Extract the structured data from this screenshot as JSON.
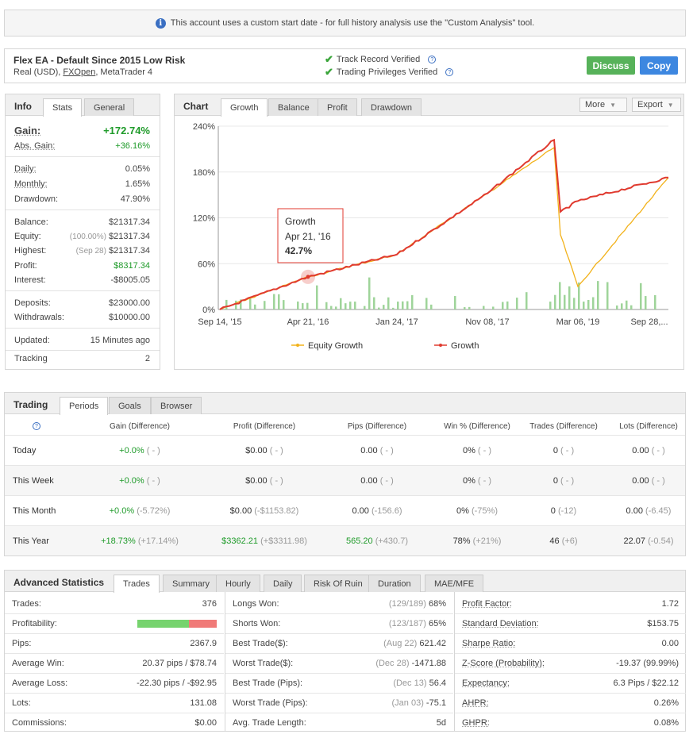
{
  "notice": {
    "text": "This account uses a custom start date - for full history analysis use the \"Custom Analysis\" tool."
  },
  "header": {
    "name": "Flex EA - Default Since 2015 Low Risk",
    "sub_pre": "Real (USD), ",
    "sub_broker": "FXOpen",
    "sub_post": ", MetaTrader 4",
    "track_record": "Track Record Verified",
    "trading_privileges": "Trading Privileges Verified",
    "discuss": "Discuss",
    "copy": "Copy"
  },
  "info": {
    "title": "Info",
    "tabs": [
      "Stats",
      "General"
    ],
    "gain_label": "Gain:",
    "gain_value": "+172.74%",
    "abs_gain_label": "Abs. Gain:",
    "abs_gain_value": "+36.16%",
    "daily_label": "Daily:",
    "daily_value": "0.05%",
    "monthly_label": "Monthly:",
    "monthly_value": "1.65%",
    "drawdown_label": "Drawdown:",
    "drawdown_value": "47.90%",
    "balance_label": "Balance:",
    "balance_value": "$21317.34",
    "equity_label": "Equity:",
    "equity_pct": "(100.00%)",
    "equity_value": "$21317.34",
    "highest_label": "Highest:",
    "highest_date": "(Sep 28)",
    "highest_value": "$21317.34",
    "profit_label": "Profit:",
    "profit_value": "$8317.34",
    "interest_label": "Interest:",
    "interest_value": "-$8005.05",
    "deposits_label": "Deposits:",
    "deposits_value": "$23000.00",
    "withdrawals_label": "Withdrawals:",
    "withdrawals_value": "$10000.00",
    "updated_label": "Updated:",
    "updated_value": "15 Minutes ago",
    "tracking_label": "Tracking",
    "tracking_value": "2"
  },
  "chart": {
    "title": "Chart",
    "tabs": [
      "Growth",
      "Balance",
      "Profit",
      "Drawdown"
    ],
    "more": "More",
    "export": "Export",
    "tooltip": {
      "series": "Growth",
      "date": "Apr 21, '16",
      "value": "42.7%"
    },
    "legend": [
      "Equity Growth",
      "Growth"
    ],
    "colors": {
      "growth": "#e03a2f",
      "equity": "#f2b21b",
      "bars": "#9fd49a"
    }
  },
  "chart_data": {
    "type": "line",
    "x_tick_labels": [
      "Sep 14, '15",
      "Apr 21, '16",
      "Jan 24, '17",
      "Nov 08, '17",
      "Mar 06, '19",
      "Sep 28,..."
    ],
    "y_tick_labels": [
      "0%",
      "60%",
      "120%",
      "180%",
      "240%"
    ],
    "ylim": [
      0,
      240
    ],
    "series": [
      {
        "name": "Growth",
        "x": [
          "Sep 14, '15",
          "Apr 21, '16",
          "Jan 24, '17",
          "Nov 08, '17",
          "Aug 2018",
          "Sep 2018",
          "Mar 06, '19",
          "Sep 28, '19"
        ],
        "values": [
          0,
          42.7,
          72,
          152,
          222,
          128,
          142,
          172.7
        ]
      },
      {
        "name": "Equity Growth",
        "x": [
          "Sep 14, '15",
          "Apr 21, '16",
          "Jan 24, '17",
          "Nov 08, '17",
          "Aug 2018",
          "Sep 2018",
          "Mar 06, '19",
          "Sep 28, '19"
        ],
        "values": [
          0,
          42.7,
          72,
          152,
          212,
          98,
          30,
          172.7
        ]
      }
    ]
  },
  "trading": {
    "title": "Trading",
    "tabs": [
      "Periods",
      "Goals",
      "Browser"
    ],
    "headers": [
      "Gain (Difference)",
      "Profit (Difference)",
      "Pips (Difference)",
      "Win % (Difference)",
      "Trades (Difference)",
      "Lots (Difference)"
    ],
    "rows": [
      {
        "period": "Today",
        "gain": "+0.0%",
        "gain_d": "( - )",
        "profit": "$0.00",
        "profit_d": "( - )",
        "pips": "0.00",
        "pips_d": "( - )",
        "win": "0%",
        "win_d": "( - )",
        "trades": "0",
        "trades_d": "( - )",
        "lots": "0.00",
        "lots_d": "( - )"
      },
      {
        "period": "This Week",
        "gain": "+0.0%",
        "gain_d": "( - )",
        "profit": "$0.00",
        "profit_d": "( - )",
        "pips": "0.00",
        "pips_d": "( - )",
        "win": "0%",
        "win_d": "( - )",
        "trades": "0",
        "trades_d": "( - )",
        "lots": "0.00",
        "lots_d": "( - )"
      },
      {
        "period": "This Month",
        "gain": "+0.0%",
        "gain_d": "(-5.72%)",
        "profit": "$0.00",
        "profit_d": "(-$1153.82)",
        "pips": "0.00",
        "pips_d": "(-156.6)",
        "win": "0%",
        "win_d": "(-75%)",
        "trades": "0",
        "trades_d": "(-12)",
        "lots": "0.00",
        "lots_d": "(-6.45)"
      },
      {
        "period": "This Year",
        "gain": "+18.73%",
        "gain_d": "(+17.14%)",
        "profit": "$3362.21",
        "profit_d": "(+$3311.98)",
        "pips": "565.20",
        "pips_d": "(+430.7)",
        "win": "78%",
        "win_d": "(+21%)",
        "trades": "46",
        "trades_d": "(+6)",
        "lots": "22.07",
        "lots_d": "(-0.54)"
      }
    ]
  },
  "advanced": {
    "title": "Advanced Statistics",
    "tabs": [
      "Trades",
      "Summary",
      "Hourly",
      "Daily",
      "Risk Of Ruin",
      "Duration",
      "MAE/MFE"
    ],
    "profitability": {
      "label": "Profitability:",
      "win_fraction": 0.65
    },
    "col1": [
      {
        "k": "Trades:",
        "v": "376"
      },
      {
        "k": "Pips:",
        "v": "2367.9"
      },
      {
        "k": "Average Win:",
        "v": "20.37 pips / $78.74"
      },
      {
        "k": "Average Loss:",
        "v": "-22.30 pips / -$92.95"
      },
      {
        "k": "Lots:",
        "v": "131.08"
      },
      {
        "k": "Commissions:",
        "v": "$0.00"
      }
    ],
    "col2": [
      {
        "k": "Longs Won:",
        "g": "(129/189)",
        "v": "68%"
      },
      {
        "k": "Shorts Won:",
        "g": "(123/187)",
        "v": "65%"
      },
      {
        "k": "Best Trade($):",
        "g": "(Aug 22)",
        "v": "621.42"
      },
      {
        "k": "Worst Trade($):",
        "g": "(Dec 28)",
        "v": "-1471.88"
      },
      {
        "k": "Best Trade (Pips):",
        "g": "(Dec 13)",
        "v": "56.4"
      },
      {
        "k": "Worst Trade (Pips):",
        "g": "(Jan 03)",
        "v": "-75.1"
      },
      {
        "k": "Avg. Trade Length:",
        "g": "",
        "v": "5d"
      }
    ],
    "col3": [
      {
        "k": "Profit Factor:",
        "v": "1.72"
      },
      {
        "k": "Standard Deviation:",
        "v": "$153.75"
      },
      {
        "k": "Sharpe Ratio:",
        "v": "0.00"
      },
      {
        "k": "Z-Score (Probability):",
        "v": "-19.37 (99.99%)"
      },
      {
        "k": "Expectancy:",
        "v": "6.3 Pips / $22.12"
      },
      {
        "k": "AHPR:",
        "v": "0.26%"
      },
      {
        "k": "GHPR:",
        "v": "0.08%"
      }
    ]
  }
}
